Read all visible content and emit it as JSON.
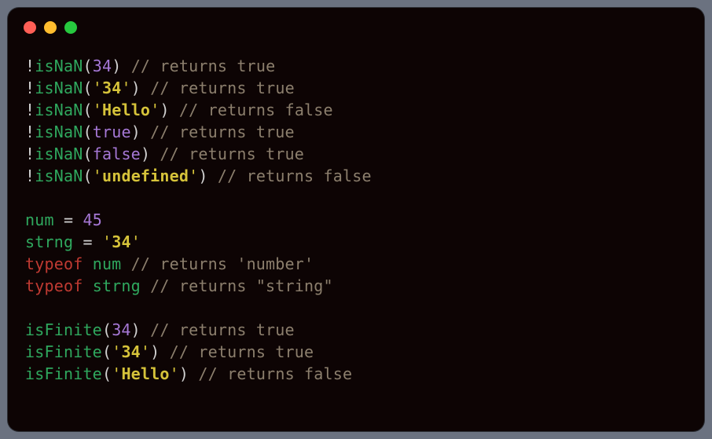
{
  "window": {
    "icons": {
      "red": "close",
      "yellow": "minimize",
      "green": "zoom"
    }
  },
  "tokens": {
    "bang": "!",
    "isNaN": "isNaN",
    "isFinite": "isFinite",
    "lpar": "(",
    "rpar": ")",
    "eq": " = ",
    "typeof": "typeof",
    "space": " "
  },
  "values": {
    "n34": "34",
    "s34": "'34'",
    "s34_body": "34",
    "hello": "'Hello'",
    "hello_body": "Hello",
    "undef": "'undefined'",
    "undef_body": "undefined",
    "true": "true",
    "false": "false",
    "n45": "45"
  },
  "vars": {
    "num": "num",
    "strng": "strng"
  },
  "comments": {
    "retTrue": " // returns true",
    "retFalse": " // returns false",
    "retNumber": " // returns 'number'",
    "retString": " // returns \"string\""
  },
  "quote": "'"
}
